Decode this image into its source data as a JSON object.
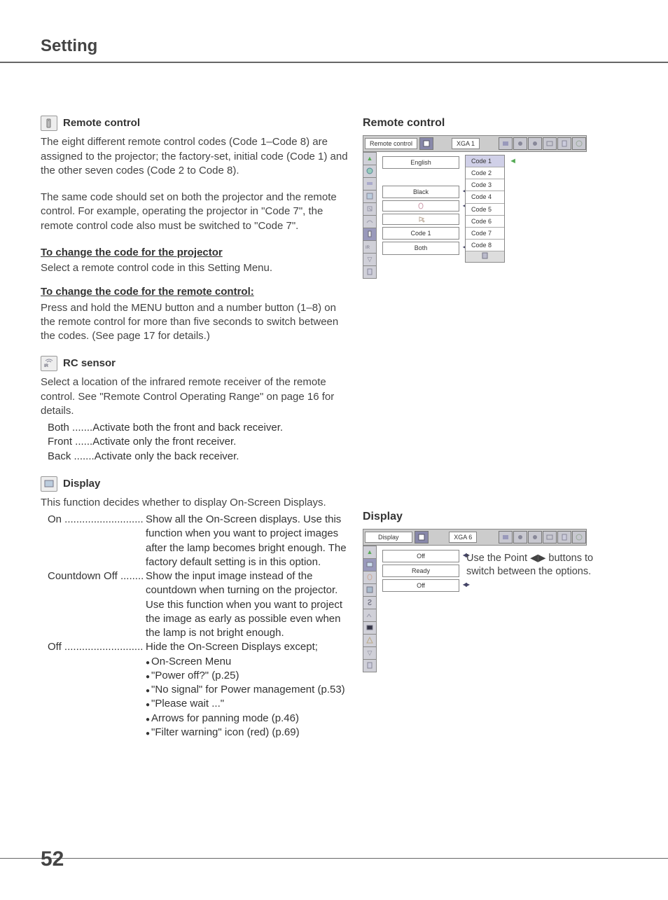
{
  "page": {
    "title": "Setting",
    "number": "52"
  },
  "remote_control": {
    "heading": "Remote control",
    "p1": "The eight different remote control codes (Code 1–Code 8) are assigned to the projector; the factory-set, initial code (Code 1) and the other seven codes (Code 2 to Code 8).",
    "p2": "The same code should set on both the projector and the remote control. For example, operating the projector in \"Code 7\", the remote control code also must be switched to \"Code 7\".",
    "sub1_title": "To change the code for the projector",
    "sub1_text": "Select a remote control code in this Setting Menu.",
    "sub2_title": "To change the code for the remote control:",
    "sub2_text": "Press and hold the MENU button and a number button (1–8) on the remote control for more than five seconds to switch between the codes. (See page 17 for details.)"
  },
  "rc_sensor": {
    "heading": "RC sensor",
    "p1": "Select a location of the infrared remote receiver of the remote control. See \"Remote Control Operating Range\" on page 16 for details.",
    "items": [
      {
        "term": "Both .......",
        "def": "Activate both the front and back receiver."
      },
      {
        "term": "Front ......",
        "def": "Activate only the front receiver."
      },
      {
        "term": "Back .......",
        "def": "Activate only the back receiver."
      }
    ]
  },
  "display": {
    "heading": "Display",
    "p1": "This function decides whether to display On-Screen Displays.",
    "items": [
      {
        "term": "On ...........................",
        "def": "Show all the On-Screen displays. Use this function when you want to project images after the lamp becomes bright enough. The factory default setting is in this option."
      },
      {
        "term": "Countdown Off ........",
        "def": "Show the input image instead of the countdown when turning on the projector. Use this function when you want to project the image as early as possible even when the lamp is not bright enough."
      },
      {
        "term": "Off ...........................",
        "def": "Hide the On-Screen Displays except;"
      }
    ],
    "bullets": [
      "On-Screen Menu",
      "\"Power off?\" (p.25)",
      "\"No signal\" for Power management (p.53)",
      "\"Please wait ...\"",
      "Arrows for panning mode (p.46)",
      "\"Filter warning\" icon (red) (p.69)"
    ]
  },
  "osd_remote": {
    "title": "Remote control",
    "toplabel": "Remote control",
    "mode": "XGA 1",
    "fields": [
      "English",
      "Black",
      "",
      "",
      "Code 1",
      "Both"
    ],
    "codes": [
      "Code 1",
      "Code 2",
      "Code 3",
      "Code 4",
      "Code 5",
      "Code 6",
      "Code 7",
      "Code 8"
    ],
    "selected_code": "Code 1"
  },
  "osd_display": {
    "title": "Display",
    "toplabel": "Display",
    "mode": "XGA 6",
    "fields": [
      "Off",
      "Ready",
      "Off"
    ],
    "note_pre": "Use the Point ",
    "note_post": " buttons to switch between the options."
  }
}
